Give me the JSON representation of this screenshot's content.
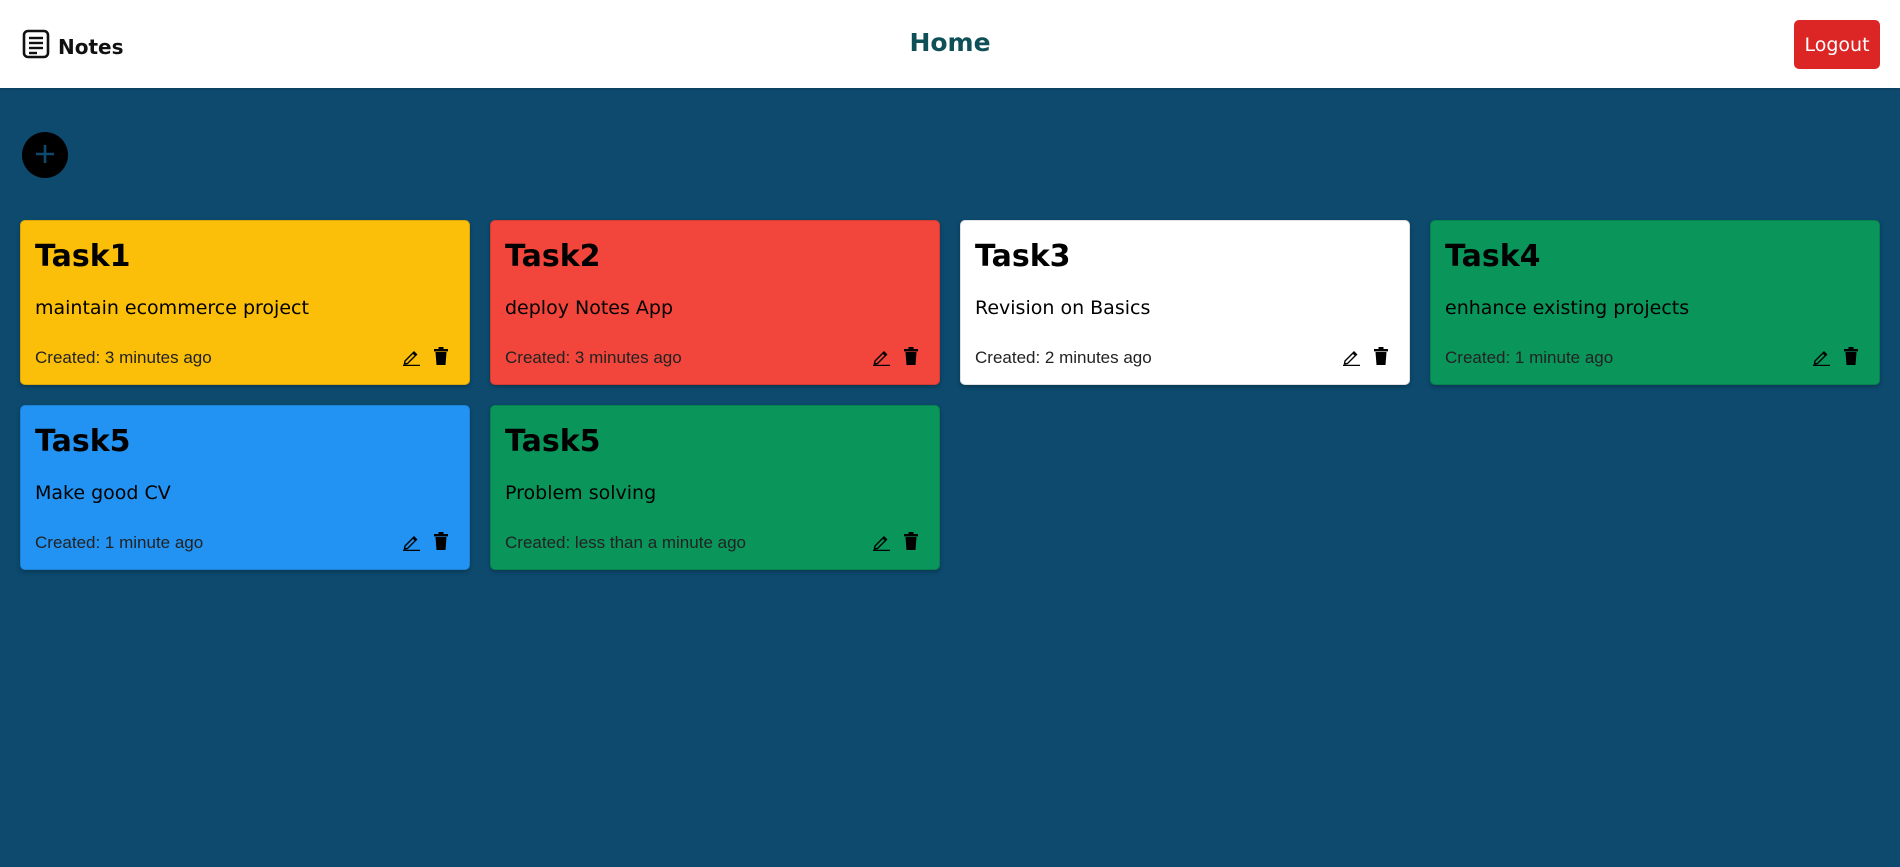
{
  "navbar": {
    "brand": "Notes",
    "brand_icon": "note-icon",
    "title": "Home",
    "logout_label": "Logout",
    "logout_color": "#dc2626"
  },
  "add_button": {
    "icon": "plus-icon"
  },
  "notes": [
    {
      "title": "Task1",
      "description": "maintain ecommerce project",
      "created": "Created: 3 minutes ago",
      "color": "#fbbf0a"
    },
    {
      "title": "Task2",
      "description": "deploy Notes App",
      "created": "Created: 3 minutes ago",
      "color": "#f2453b"
    },
    {
      "title": "Task3",
      "description": "Revision on Basics",
      "created": "Created: 2 minutes ago",
      "color": "#ffffff"
    },
    {
      "title": "Task4",
      "description": "enhance existing projects",
      "created": "Created: 1 minute ago",
      "color": "#0a955b"
    },
    {
      "title": "Task5",
      "description": "Make good CV",
      "created": "Created: 1 minute ago",
      "color": "#2293f2"
    },
    {
      "title": "Task5",
      "description": "Problem solving",
      "created": "Created: less than a minute ago",
      "color": "#0a955b"
    }
  ],
  "colors": {
    "page_background": "#0d4a6e",
    "title_color": "#0f4f58"
  }
}
